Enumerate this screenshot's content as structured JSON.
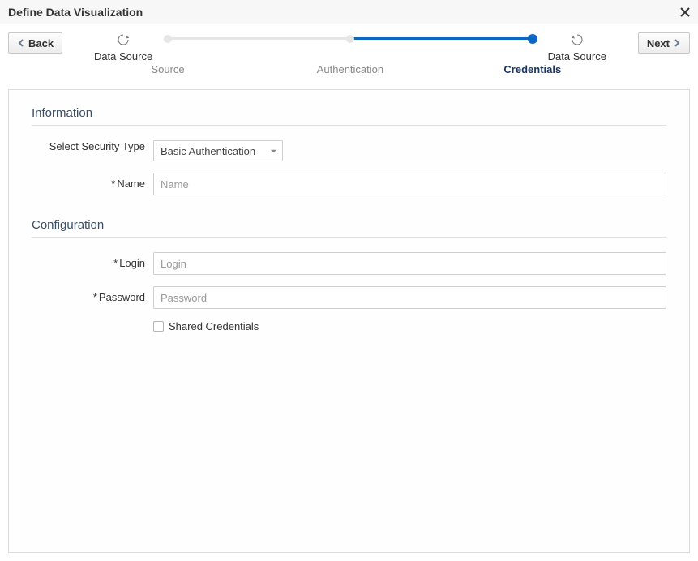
{
  "header": {
    "title": "Define Data Visualization"
  },
  "nav": {
    "back_label": "Back",
    "next_label": "Next"
  },
  "wizard": {
    "start_label": "Data Source",
    "end_label": "Data Source",
    "steps": {
      "source": "Source",
      "authentication": "Authentication",
      "credentials": "Credentials"
    }
  },
  "sections": {
    "information_title": "Information",
    "configuration_title": "Configuration"
  },
  "fields": {
    "security_type_label": "Select Security Type",
    "security_type_value": "Basic Authentication",
    "name_label": "Name",
    "name_placeholder": "Name",
    "login_label": "Login",
    "login_placeholder": "Login",
    "password_label": "Password",
    "password_placeholder": "Password",
    "shared_credentials_label": "Shared Credentials"
  }
}
